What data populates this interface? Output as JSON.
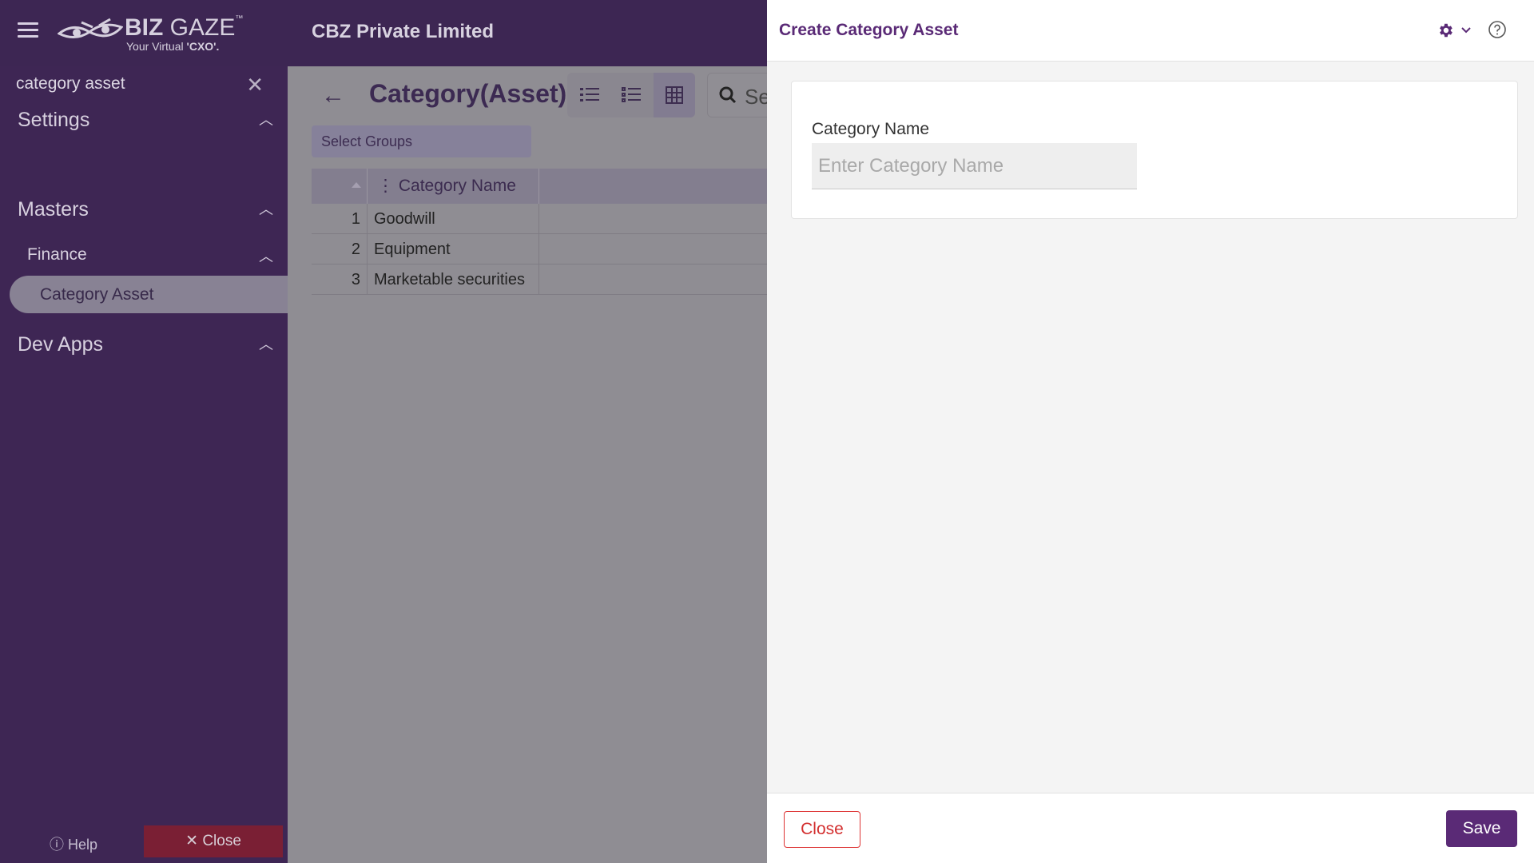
{
  "app": {
    "brand": "BIZ GAZE",
    "brand_bold": "BIZ",
    "brand_light": "GAZE",
    "tagline_prefix": "Your Virtual",
    "tagline_bold": "'CXO'.",
    "company": "CBZ Private Limited"
  },
  "sidebar": {
    "search_value": "category asset",
    "sections": [
      {
        "label": "Settings"
      },
      {
        "label": "Masters"
      },
      {
        "label": "Dev Apps"
      }
    ],
    "subsection": {
      "label": "Finance"
    },
    "active_item": {
      "label": "Category Asset"
    },
    "help_label": "Help",
    "close_label": "Close"
  },
  "main": {
    "title": "Category(Asset)",
    "search_placeholder": "Se",
    "select_groups_label": "Select Groups",
    "grid": {
      "columns": [
        "Category Name"
      ],
      "rows": [
        {
          "num": "1",
          "name": "Goodwill"
        },
        {
          "num": "2",
          "name": "Equipment"
        },
        {
          "num": "3",
          "name": "Marketable securities"
        }
      ]
    }
  },
  "drawer": {
    "title": "Create Category Asset",
    "field_label": "Category Name",
    "field_placeholder": "Enter Category Name",
    "field_value": "",
    "close_label": "Close",
    "save_label": "Save"
  },
  "colors": {
    "accent": "#5a2a76",
    "danger": "#d32f2f",
    "topbar": "#3d2653"
  },
  "icons": [
    "menu-icon",
    "close-icon",
    "chevron-up-icon",
    "help-icon",
    "back-arrow-icon",
    "list-view-icon",
    "detail-list-icon",
    "grid-view-icon",
    "search-icon",
    "sort-icon",
    "gear-icon",
    "chevron-down-icon",
    "question-circle-icon"
  ]
}
